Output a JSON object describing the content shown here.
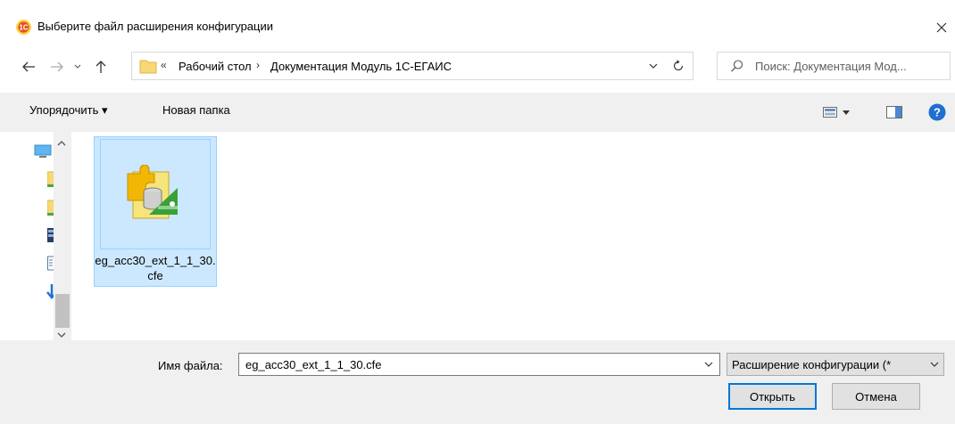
{
  "window": {
    "title": "Выберите файл расширения конфигурации"
  },
  "address": {
    "overflow_glyph": "«",
    "crumbs": [
      "Рабочий стол",
      "Документация Модуль 1С-ЕГАИС"
    ],
    "separator": "›"
  },
  "search": {
    "placeholder": "Поиск: Документация Мод..."
  },
  "toolbar": {
    "organize_label": "Упорядочить ▾",
    "new_folder_label": "Новая папка"
  },
  "files": [
    {
      "name": "eg_acc30_ext_1_1_30.cfe",
      "icon": "1c-extension-icon",
      "selected": true
    }
  ],
  "bottom": {
    "filename_label": "Имя файла:",
    "filename_value": "eg_acc30_ext_1_1_30.cfe",
    "filetype_value": "Расширение конфигурации (*",
    "open_label": "Открыть",
    "cancel_label": "Отмена"
  },
  "colors": {
    "accent": "#0078d7",
    "selection": "#cce8ff",
    "toolbar_bg": "#f0f0f0",
    "logo": "#e5531a"
  }
}
